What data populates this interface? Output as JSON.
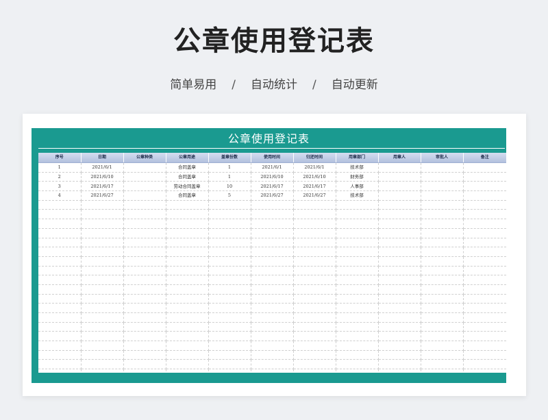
{
  "page": {
    "title": "公章使用登记表",
    "subtitle": {
      "items": [
        "简单易用",
        "自动统计",
        "自动更新"
      ],
      "separator": "/"
    }
  },
  "sheet": {
    "title": "公章使用登记表",
    "frame_color": "#1a9a90",
    "header_color": "#b2c0de",
    "columns": [
      "序号",
      "日期",
      "公章种类",
      "公章用途",
      "盖章份数",
      "使用时间",
      "归还时间",
      "用章部门",
      "用章人",
      "审批人",
      "备注"
    ],
    "rows": [
      [
        "1",
        "2021/6/1",
        "",
        "合同盖章",
        "1",
        "2021/6/1",
        "2021/6/1",
        "技术部",
        "",
        "",
        ""
      ],
      [
        "2",
        "2021/6/10",
        "",
        "合同盖章",
        "1",
        "2021/6/10",
        "2021/6/10",
        "财务部",
        "",
        "",
        ""
      ],
      [
        "3",
        "2021/6/17",
        "",
        "劳动合同盖章",
        "10",
        "2021/6/17",
        "2021/6/17",
        "人事部",
        "",
        "",
        ""
      ],
      [
        "4",
        "2021/6/27",
        "",
        "合同盖章",
        "5",
        "2021/6/27",
        "2021/6/27",
        "技术部",
        "",
        "",
        ""
      ]
    ],
    "empty_rows": 20
  }
}
